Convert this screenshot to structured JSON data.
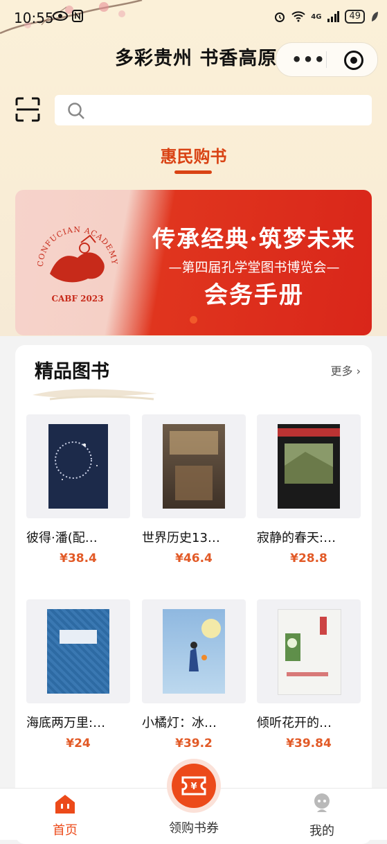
{
  "status_bar": {
    "time": "10:55",
    "network": "4G",
    "battery": "49"
  },
  "header": {
    "title": "多彩贵州 书香高原"
  },
  "search": {
    "placeholder": ""
  },
  "tab": {
    "label": "惠民购书"
  },
  "banner": {
    "logo_ring_text": "CONFUCIAN ACADEMY BOOK FAIR",
    "logo_year_text": "CABF 2023",
    "line1": "传承经典·筑梦未来",
    "line2": "—第四届孔学堂图书博览会—",
    "line3": "会务手册"
  },
  "section": {
    "title": "精品图书",
    "more": "更多"
  },
  "books": [
    {
      "name": "彼得·潘(配…",
      "price": "¥38.4",
      "cover_color": "#1c2a4a"
    },
    {
      "name": "世界历史13…",
      "price": "¥46.4",
      "cover_color": "#5a4a3a"
    },
    {
      "name": "寂静的春天:…",
      "price": "¥28.8",
      "cover_color": "#1a1a1a"
    },
    {
      "name": "海底两万里:…",
      "price": "¥24",
      "cover_color": "#2d6aa3"
    },
    {
      "name": "小橘灯：冰…",
      "price": "¥39.2",
      "cover_color": "#9fc7e6"
    },
    {
      "name": "倾听花开的…",
      "price": "¥39.84",
      "cover_color": "#f4f4f1"
    }
  ],
  "nav": {
    "home": "首页",
    "coupon": "领购书券",
    "mine": "我的"
  },
  "colors": {
    "accent": "#d94314",
    "price": "#e25a27",
    "banner_red": "#d9261a"
  }
}
